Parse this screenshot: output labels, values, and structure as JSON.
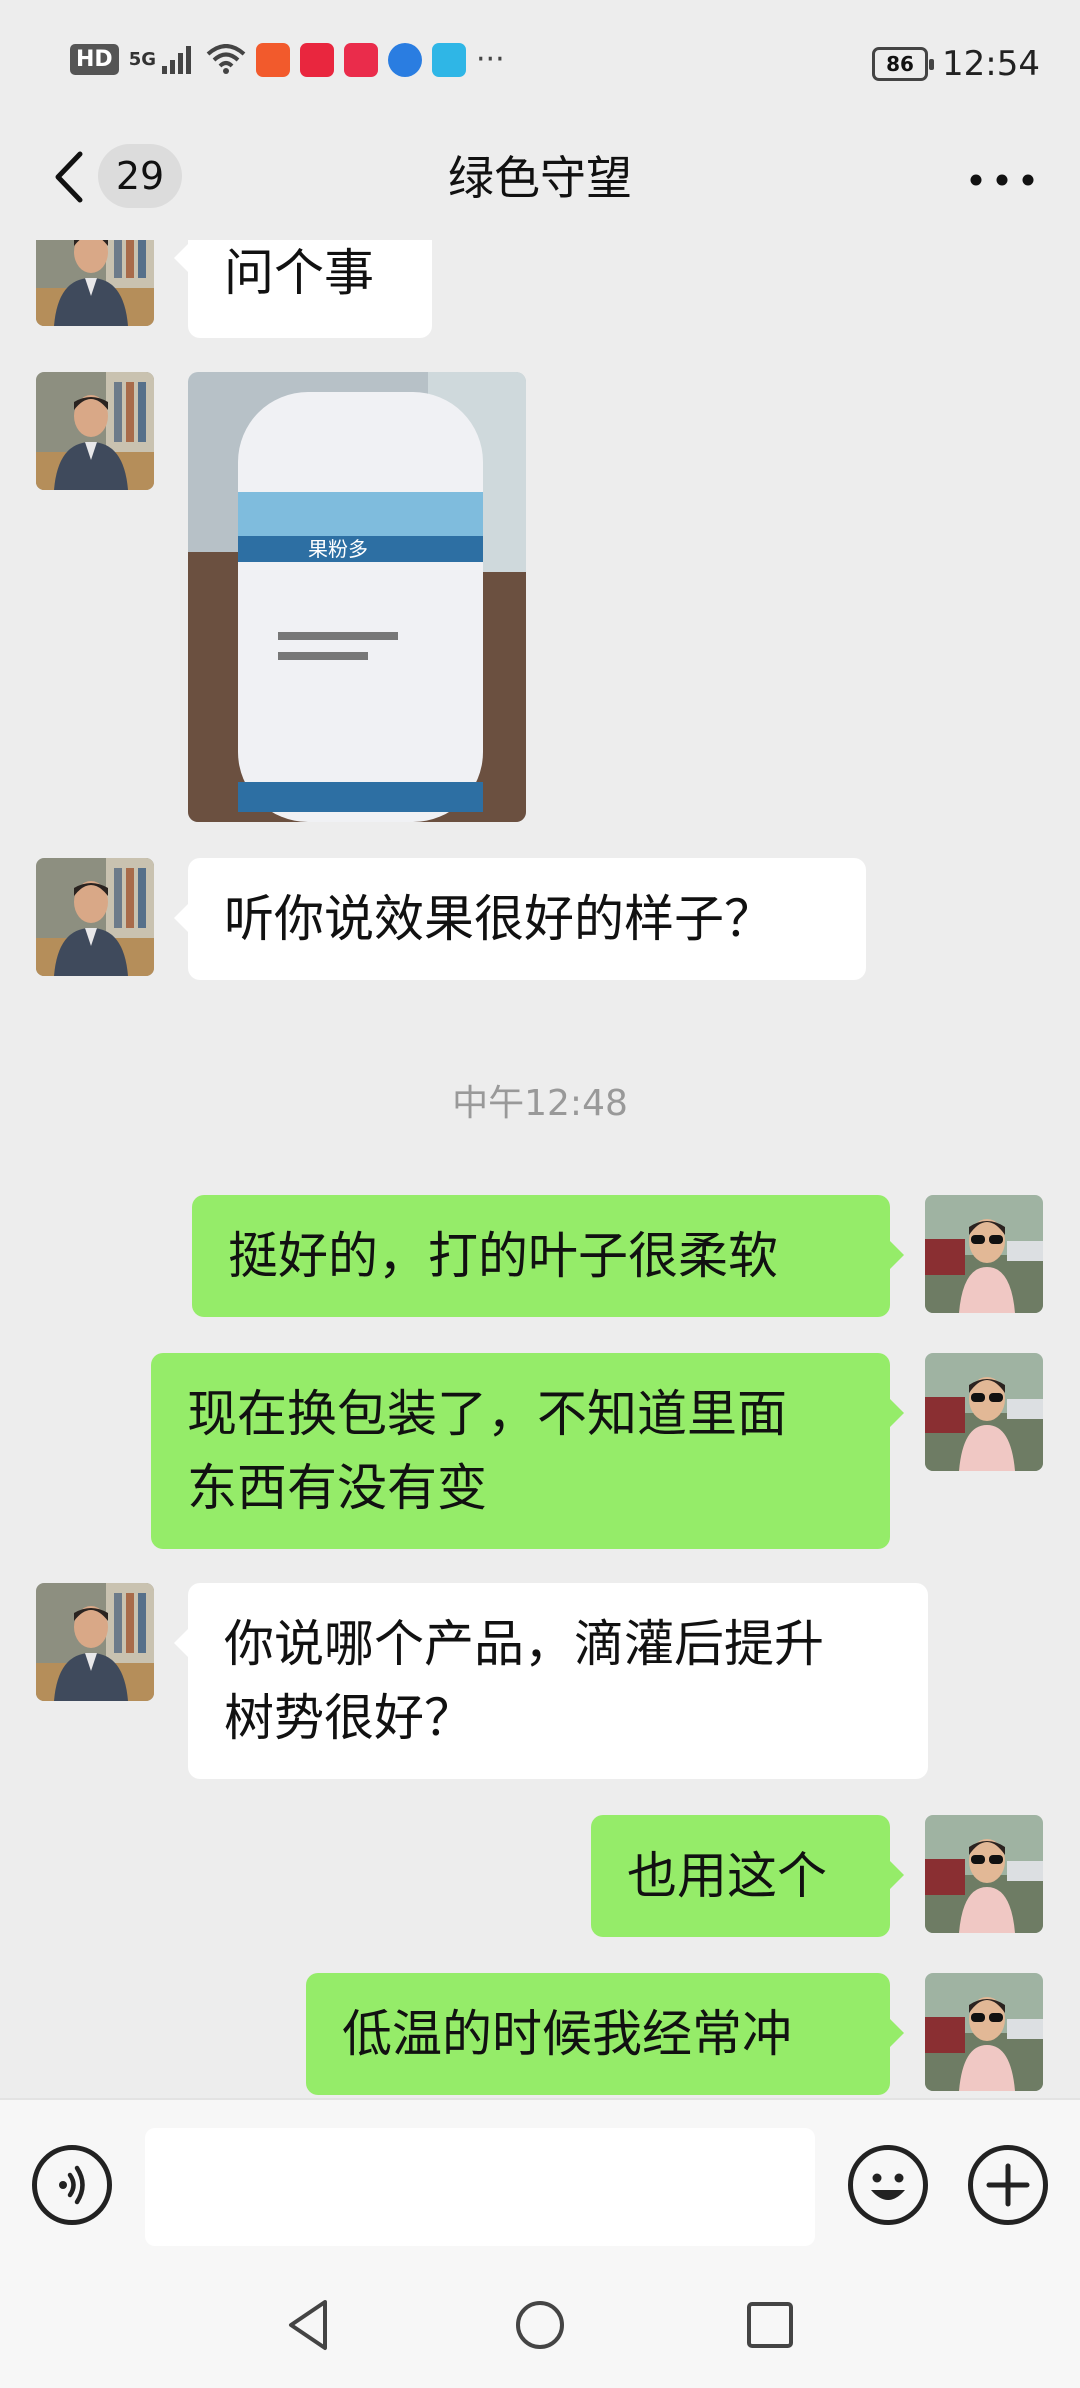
{
  "status_bar": {
    "network": "HD",
    "signal": "5G",
    "more": "···",
    "battery": "86",
    "time": "12:54"
  },
  "header": {
    "unread_count": "29",
    "title": "绿色守望"
  },
  "messages": [
    {
      "side": "left",
      "lines": [
        "问个事"
      ]
    },
    {
      "side": "left",
      "type": "image",
      "image_label": "果粉多"
    },
    {
      "side": "left",
      "lines": [
        "听你说效果很好的样子？"
      ]
    },
    {
      "type": "timestamp",
      "text": "中午12:48"
    },
    {
      "side": "right",
      "lines": [
        "挺好的，打的叶子很柔软"
      ]
    },
    {
      "side": "right",
      "lines": [
        "现在换包装了，不知道里面",
        "东西有没有变"
      ]
    },
    {
      "side": "left",
      "lines": [
        "你说哪个产品，滴灌后提升",
        "树势很好？"
      ]
    },
    {
      "side": "right",
      "lines": [
        "也用这个"
      ]
    },
    {
      "side": "right",
      "lines": [
        "低温的时候我经常冲"
      ]
    }
  ],
  "input": {
    "value": "",
    "placeholder": ""
  },
  "colors": {
    "background": "#ededed",
    "left_bubble": "#ffffff",
    "right_bubble": "#95ec69"
  }
}
